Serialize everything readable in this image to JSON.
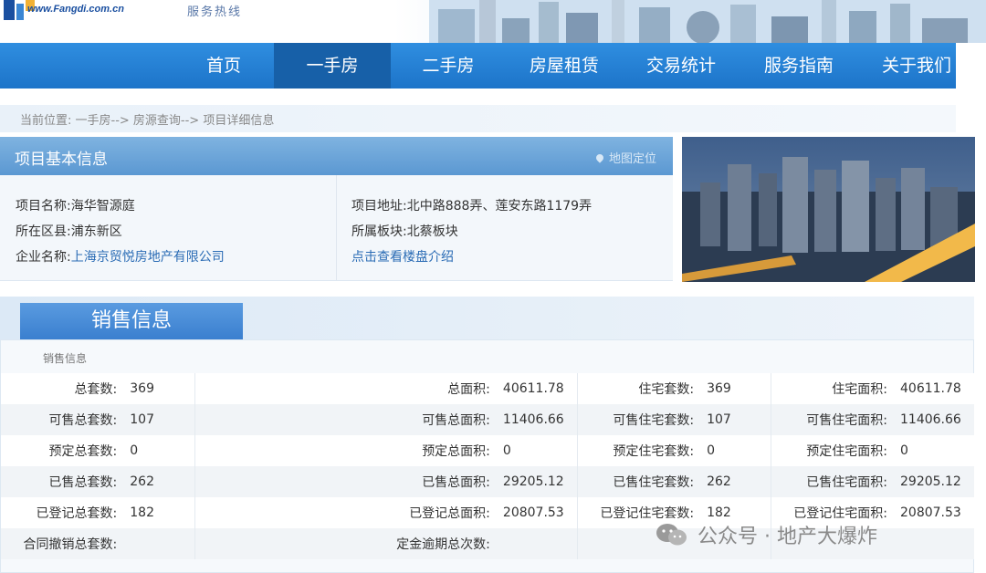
{
  "header": {
    "site_url": "www.Fangdi.com.cn",
    "hotline": "服务热线"
  },
  "nav": {
    "items": [
      "首页",
      "一手房",
      "二手房",
      "房屋租赁",
      "交易统计",
      "服务指南",
      "关于我们"
    ],
    "active": "一手房"
  },
  "breadcrumb": "当前位置:  一手房--> 房源查询--> 项目详细信息",
  "project": {
    "section_title": "项目基本信息",
    "map_link": "地图定位",
    "name_label": "项目名称:",
    "name": "海华智源庭",
    "district_label": "所在区县:",
    "district": "浦东新区",
    "company_label": "企业名称:",
    "company": "上海京贸悦房地产有限公司",
    "address_label": "项目地址:",
    "address": "北中路888弄、莲安东路1179弄",
    "block_label": "所属板块:",
    "block": "北蔡板块",
    "intro_link": "点击查看楼盘介绍"
  },
  "sales": {
    "tab_label": "销售信息",
    "sub_label": "销售信息",
    "rows": [
      [
        [
          "总套数:",
          "369"
        ],
        [
          "总面积:",
          "40611.78"
        ],
        [
          "住宅套数:",
          "369"
        ],
        [
          "住宅面积:",
          "40611.78"
        ]
      ],
      [
        [
          "可售总套数:",
          "107"
        ],
        [
          "可售总面积:",
          "11406.66"
        ],
        [
          "可售住宅套数:",
          "107"
        ],
        [
          "可售住宅面积:",
          "11406.66"
        ]
      ],
      [
        [
          "预定总套数:",
          "0"
        ],
        [
          "预定总面积:",
          "0"
        ],
        [
          "预定住宅套数:",
          "0"
        ],
        [
          "预定住宅面积:",
          "0"
        ]
      ],
      [
        [
          "已售总套数:",
          "262"
        ],
        [
          "已售总面积:",
          "29205.12"
        ],
        [
          "已售住宅套数:",
          "262"
        ],
        [
          "已售住宅面积:",
          "29205.12"
        ]
      ],
      [
        [
          "已登记总套数:",
          "182"
        ],
        [
          "已登记总面积:",
          "20807.53"
        ],
        [
          "已登记住宅套数:",
          "182"
        ],
        [
          "已登记住宅面积:",
          "20807.53"
        ]
      ],
      [
        [
          "合同撤销总套数:",
          ""
        ],
        [
          "定金逾期总次数:",
          ""
        ],
        [
          "",
          ""
        ],
        [
          "",
          ""
        ]
      ]
    ]
  },
  "watermark": "公众号 · 地产大爆炸",
  "colors": {
    "nav_bg": "#1d74c9",
    "nav_active": "#1760a8",
    "panel_head": "#5b98d2",
    "link": "#2b6cb5"
  }
}
